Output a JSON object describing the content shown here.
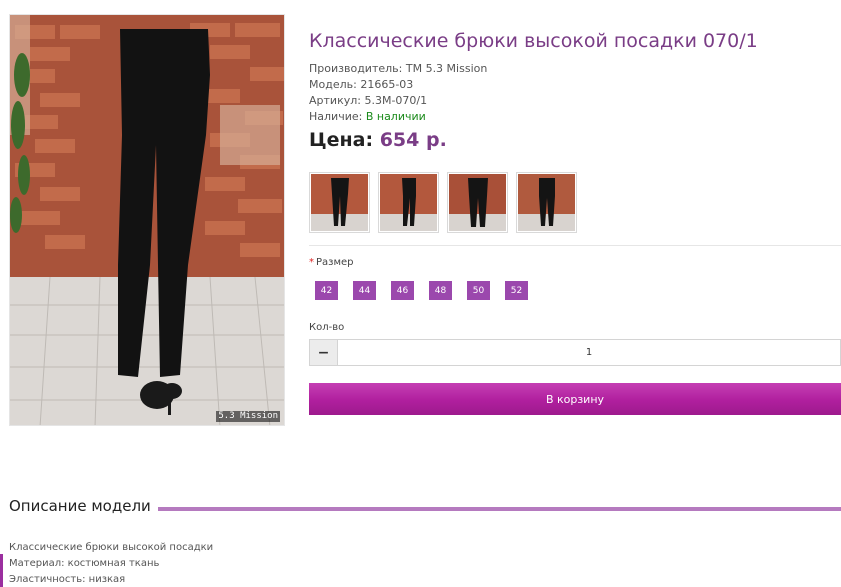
{
  "product": {
    "title": "Классические брюки высокой посадки 070/1",
    "manufacturer_label": "Производитель:",
    "manufacturer_value": "ТМ 5.3 Mission",
    "model_label": "Модель:",
    "model_value": "21665-03",
    "sku_label": "Артикул:",
    "sku_value": "5.3М-070/1",
    "availability_label": "Наличие:",
    "availability_value": "В наличии",
    "price_label": "Цена:",
    "price_value": "654 р.",
    "watermark": "5.3 Mission"
  },
  "gallery": {
    "thumbnails": [
      "trousers-front-icon",
      "trousers-side-icon",
      "trousers-front-icon",
      "trousers-back-icon"
    ]
  },
  "options": {
    "size_required_mark": "*",
    "size_label": "Размер",
    "sizes": [
      "42",
      "44",
      "46",
      "48",
      "50",
      "52"
    ],
    "qty_label": "Кол-во",
    "qty_minus": "−",
    "qty_value": "1"
  },
  "cart": {
    "button_label": "В корзину"
  },
  "description": {
    "heading": "Описание модели",
    "lines": [
      "Классические брюки высокой посадки",
      "Материал: костюмная ткань",
      "Эластичность: низкая"
    ]
  },
  "colors": {
    "accent": "#7a3d86",
    "button": "#b01f9e",
    "size_bg": "#9b48ad",
    "in_stock": "#1a8a1a"
  }
}
